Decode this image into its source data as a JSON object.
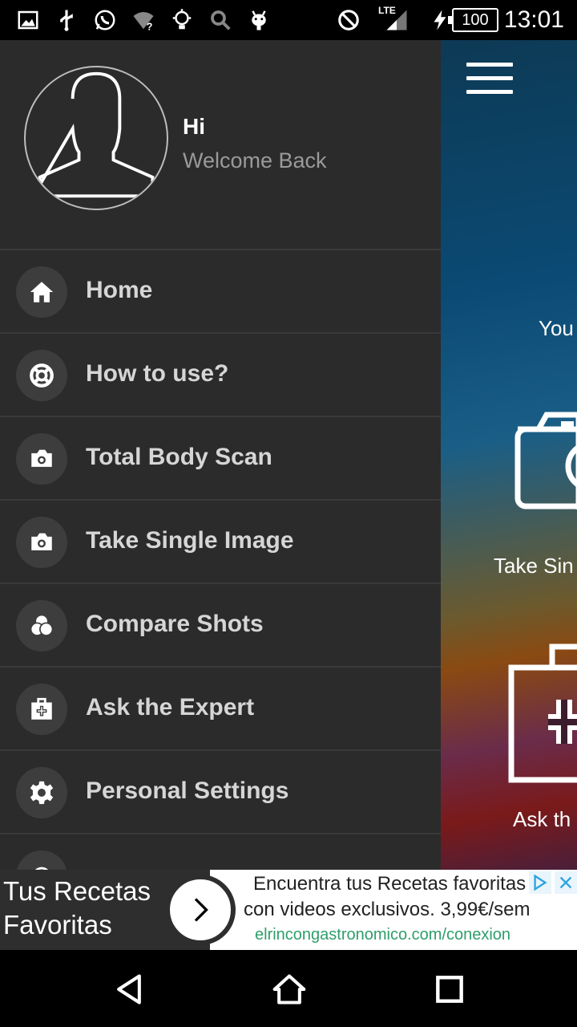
{
  "status_bar": {
    "time": "13:01",
    "battery": "100",
    "network": "LTE",
    "icons": [
      "gallery-icon",
      "usb-icon",
      "whatsapp-icon",
      "wifi-unknown-icon",
      "bulb-icon",
      "search-icon",
      "android-icon",
      "do-not-disturb-icon",
      "signal-icon",
      "charging-icon"
    ]
  },
  "drawer": {
    "greeting": "Hi",
    "welcome": "Welcome Back",
    "items": [
      {
        "label": "Home",
        "icon": "home-icon"
      },
      {
        "label": "How to use?",
        "icon": "lifebuoy-icon"
      },
      {
        "label": "Total Body Scan",
        "icon": "camera-icon"
      },
      {
        "label": "Take Single Image",
        "icon": "camera-icon"
      },
      {
        "label": "Compare Shots",
        "icon": "overlap-circles-icon"
      },
      {
        "label": "Ask the Expert",
        "icon": "medical-kit-icon"
      },
      {
        "label": "Personal Settings",
        "icon": "gear-icon"
      },
      {
        "label": "",
        "icon": "partial-icon"
      }
    ]
  },
  "background_app": {
    "text_you": "You",
    "text_take": "Take Sin",
    "text_ask": "Ask th"
  },
  "ad": {
    "left_title": "Tus Recetas Favoritas",
    "line1": "Encuentra tus Recetas favoritas",
    "line2": "con videos exclusivos. 3,99€/sem",
    "url": "elrincongastronomico.com/conexion"
  },
  "colors": {
    "drawer_bg": "#2b2b2b",
    "icon_circle": "#3d3d3d",
    "menu_text": "#d6d6d6",
    "ad_url": "#2e9e6a"
  }
}
